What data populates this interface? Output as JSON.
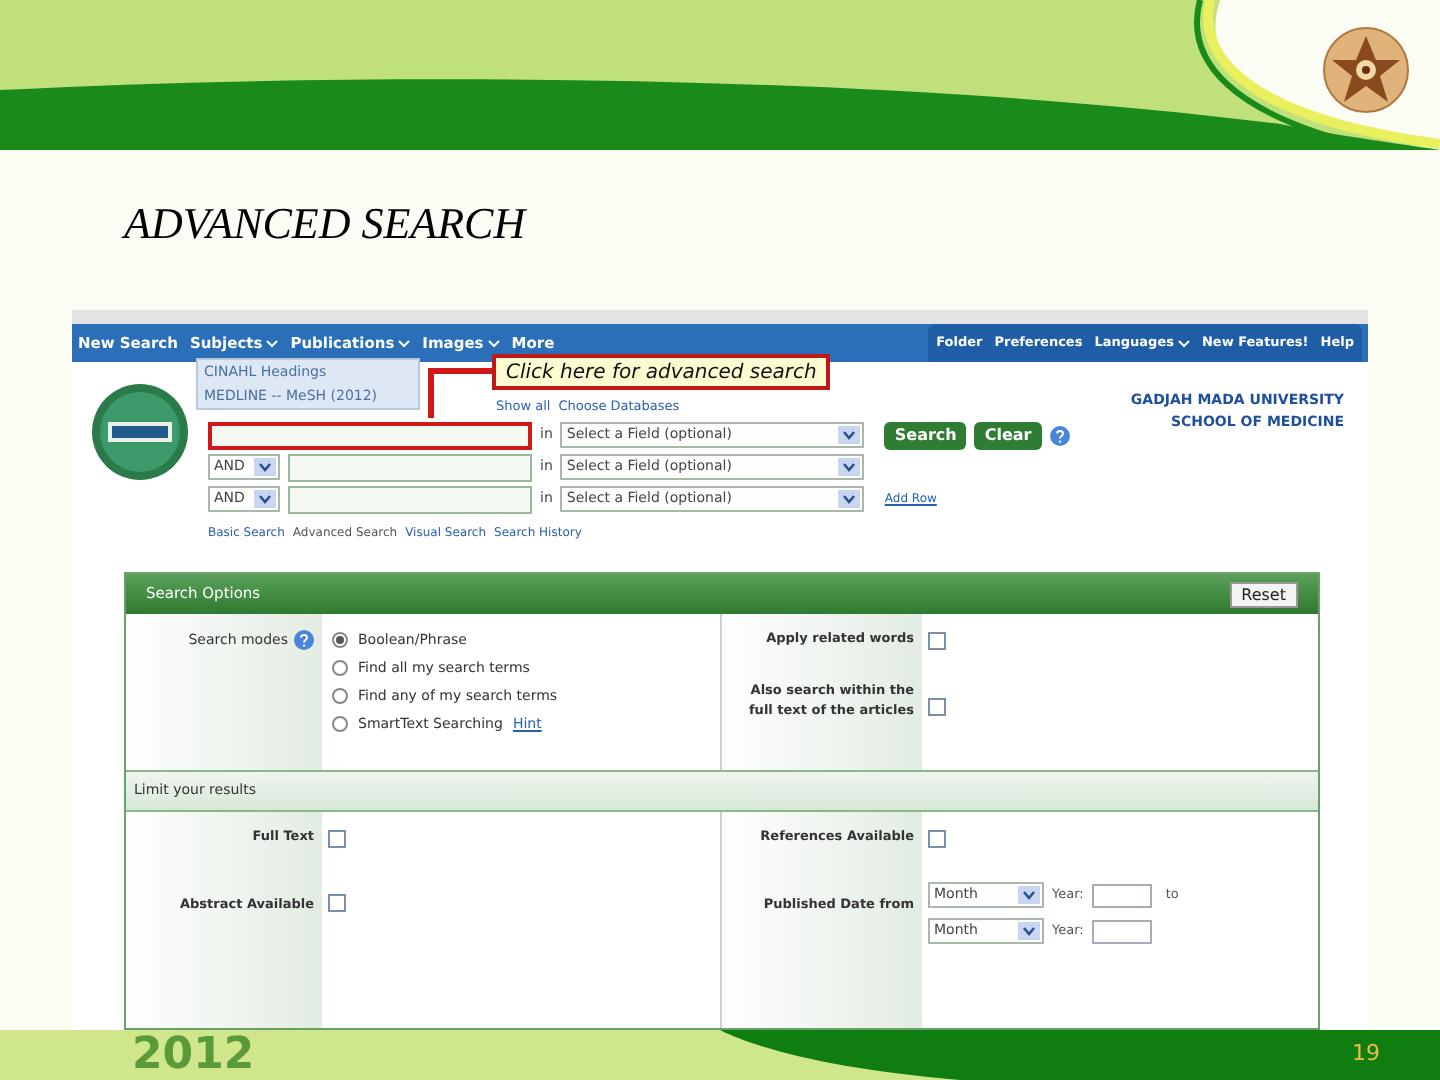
{
  "slide": {
    "title": "ADVANCED SEARCH",
    "year": "2012",
    "page_number": "19"
  },
  "screenshot": {
    "nav_left": [
      {
        "label": "New Search",
        "dropdown": false
      },
      {
        "label": "Subjects",
        "dropdown": true
      },
      {
        "label": "Publications",
        "dropdown": true
      },
      {
        "label": "Images",
        "dropdown": true
      },
      {
        "label": "More",
        "dropdown": false
      }
    ],
    "subjects_menu": [
      "CINAHL Headings",
      "MEDLINE -- MeSH (2012)"
    ],
    "nav_right": [
      {
        "label": "Folder",
        "dropdown": false
      },
      {
        "label": "Preferences",
        "dropdown": false
      },
      {
        "label": "Languages",
        "dropdown": true
      },
      {
        "label": "New Features!",
        "dropdown": false
      },
      {
        "label": "Help",
        "dropdown": false
      }
    ],
    "database_links": [
      "Show all",
      "Choose Databases"
    ],
    "search_rows": [
      {
        "operator": "",
        "in_label": "in",
        "field": "Select a Field (optional)",
        "highlighted": true
      },
      {
        "operator": "AND",
        "in_label": "in",
        "field": "Select a Field (optional)",
        "highlighted": false
      },
      {
        "operator": "AND",
        "in_label": "in",
        "field": "Select a Field (optional)",
        "highlighted": false
      }
    ],
    "buttons": [
      "Search",
      "Clear"
    ],
    "add_row": "Add Row",
    "institution": [
      "GADJAH MADA UNIVERSITY",
      "SCHOOL OF MEDICINE"
    ],
    "search_links": [
      {
        "label": "Basic Search",
        "selected": false
      },
      {
        "label": "Advanced Search",
        "selected": true
      },
      {
        "label": "Visual Search",
        "selected": false
      },
      {
        "label": "Search History",
        "selected": false
      }
    ],
    "callout": "Click here for advanced search",
    "options": {
      "title": "Search Options",
      "reset": "Reset",
      "search_modes_label": "Search modes",
      "modes": [
        {
          "label": "Boolean/Phrase",
          "selected": true
        },
        {
          "label": "Find all my search terms",
          "selected": false
        },
        {
          "label": "Find any of my search terms",
          "selected": false
        },
        {
          "label": "SmartText Searching",
          "selected": false,
          "hint": "Hint"
        }
      ],
      "right_checks": [
        {
          "label": "Apply related words",
          "checked": false
        },
        {
          "label": "Also search within the full text of the articles",
          "checked": false
        }
      ],
      "limit_title": "Limit your results",
      "limit_left": [
        {
          "label": "Full Text",
          "checked": false
        },
        {
          "label": "Abstract Available",
          "checked": false
        }
      ],
      "limit_right": [
        {
          "label": "References Available",
          "checked": false
        }
      ],
      "published_date": {
        "label": "Published Date from",
        "rows": [
          {
            "month": "Month",
            "year_label": "Year:",
            "suffix": "to"
          },
          {
            "month": "Month",
            "year_label": "Year:"
          }
        ]
      }
    }
  }
}
